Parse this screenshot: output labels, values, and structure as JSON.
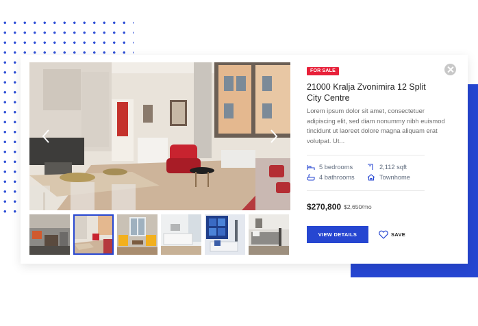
{
  "listing": {
    "badge": "FOR SALE",
    "title": "21000 Kralja Zvonimira 12 Split City Centre",
    "description": "Lorem ipsum dolor sit amet, consectetuer adipiscing elit, sed diam nonummy nibh euismod tincidunt ut laoreet dolore magna aliquam erat volutpat. Ut...",
    "features": {
      "bedrooms": "5 bedrooms",
      "bathrooms": "4 bathrooms",
      "area": "2,112 sqft",
      "type": "Townhome"
    },
    "price": "$270,800",
    "monthly": "$2,650/mo",
    "actions": {
      "details_label": "VIEW DETAILS",
      "save_label": "SAVE"
    }
  },
  "gallery": {
    "thumbnail_count": 6,
    "selected_index": 1
  },
  "icons": {
    "close": "close-icon",
    "prev": "chevron-left-icon",
    "next": "chevron-right-icon",
    "bed": "bed-icon",
    "bath": "bath-icon",
    "area": "area-icon",
    "home": "home-icon",
    "save": "heart-icon"
  },
  "colors": {
    "accent": "#2646d1",
    "badge": "#e8213a",
    "text": "#222222",
    "muted": "#6d6d6d"
  }
}
